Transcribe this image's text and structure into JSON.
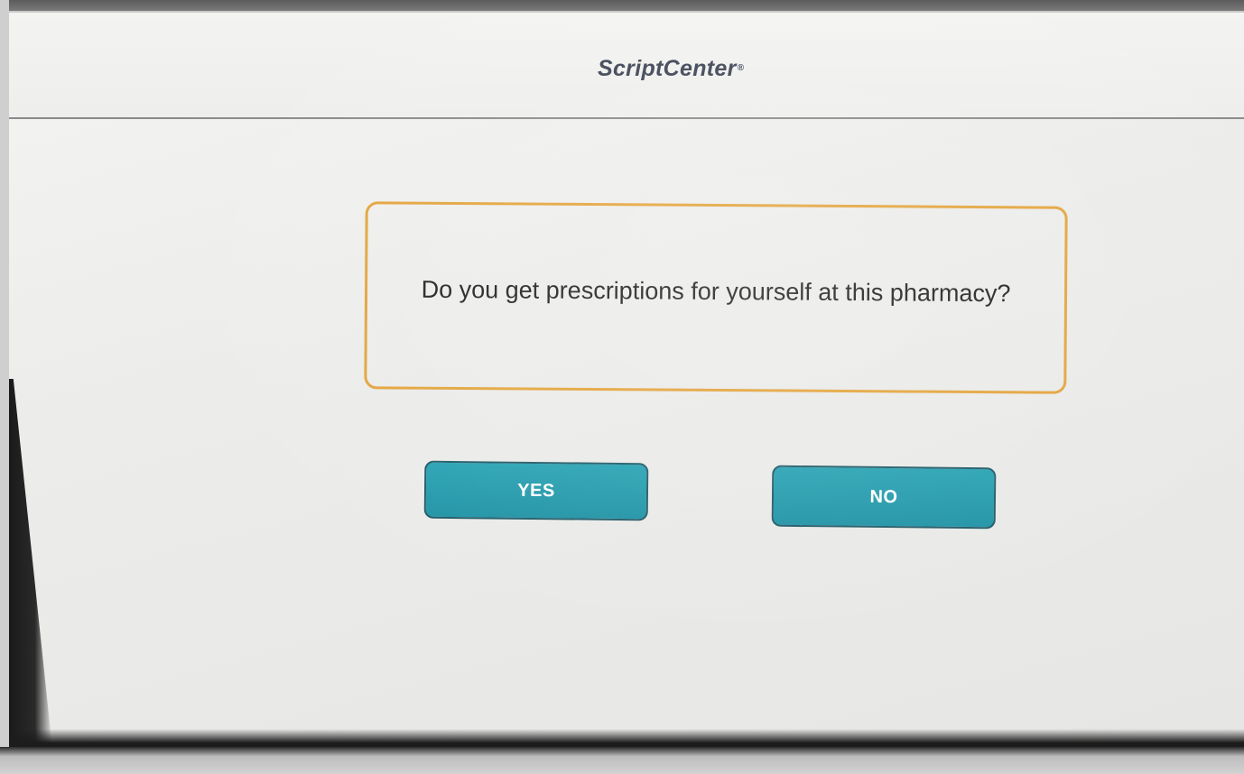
{
  "app": {
    "logo_text": "ScriptCenter",
    "logo_mark": "®"
  },
  "prompt": {
    "question": "Do you get prescriptions for yourself at this pharmacy?"
  },
  "buttons": {
    "yes_label": "YES",
    "no_label": "NO"
  },
  "colors": {
    "accent_border": "#e3a33a",
    "button_fill": "#1f93a5",
    "button_text": "#ffffff",
    "logo_text": "#3b4253"
  }
}
